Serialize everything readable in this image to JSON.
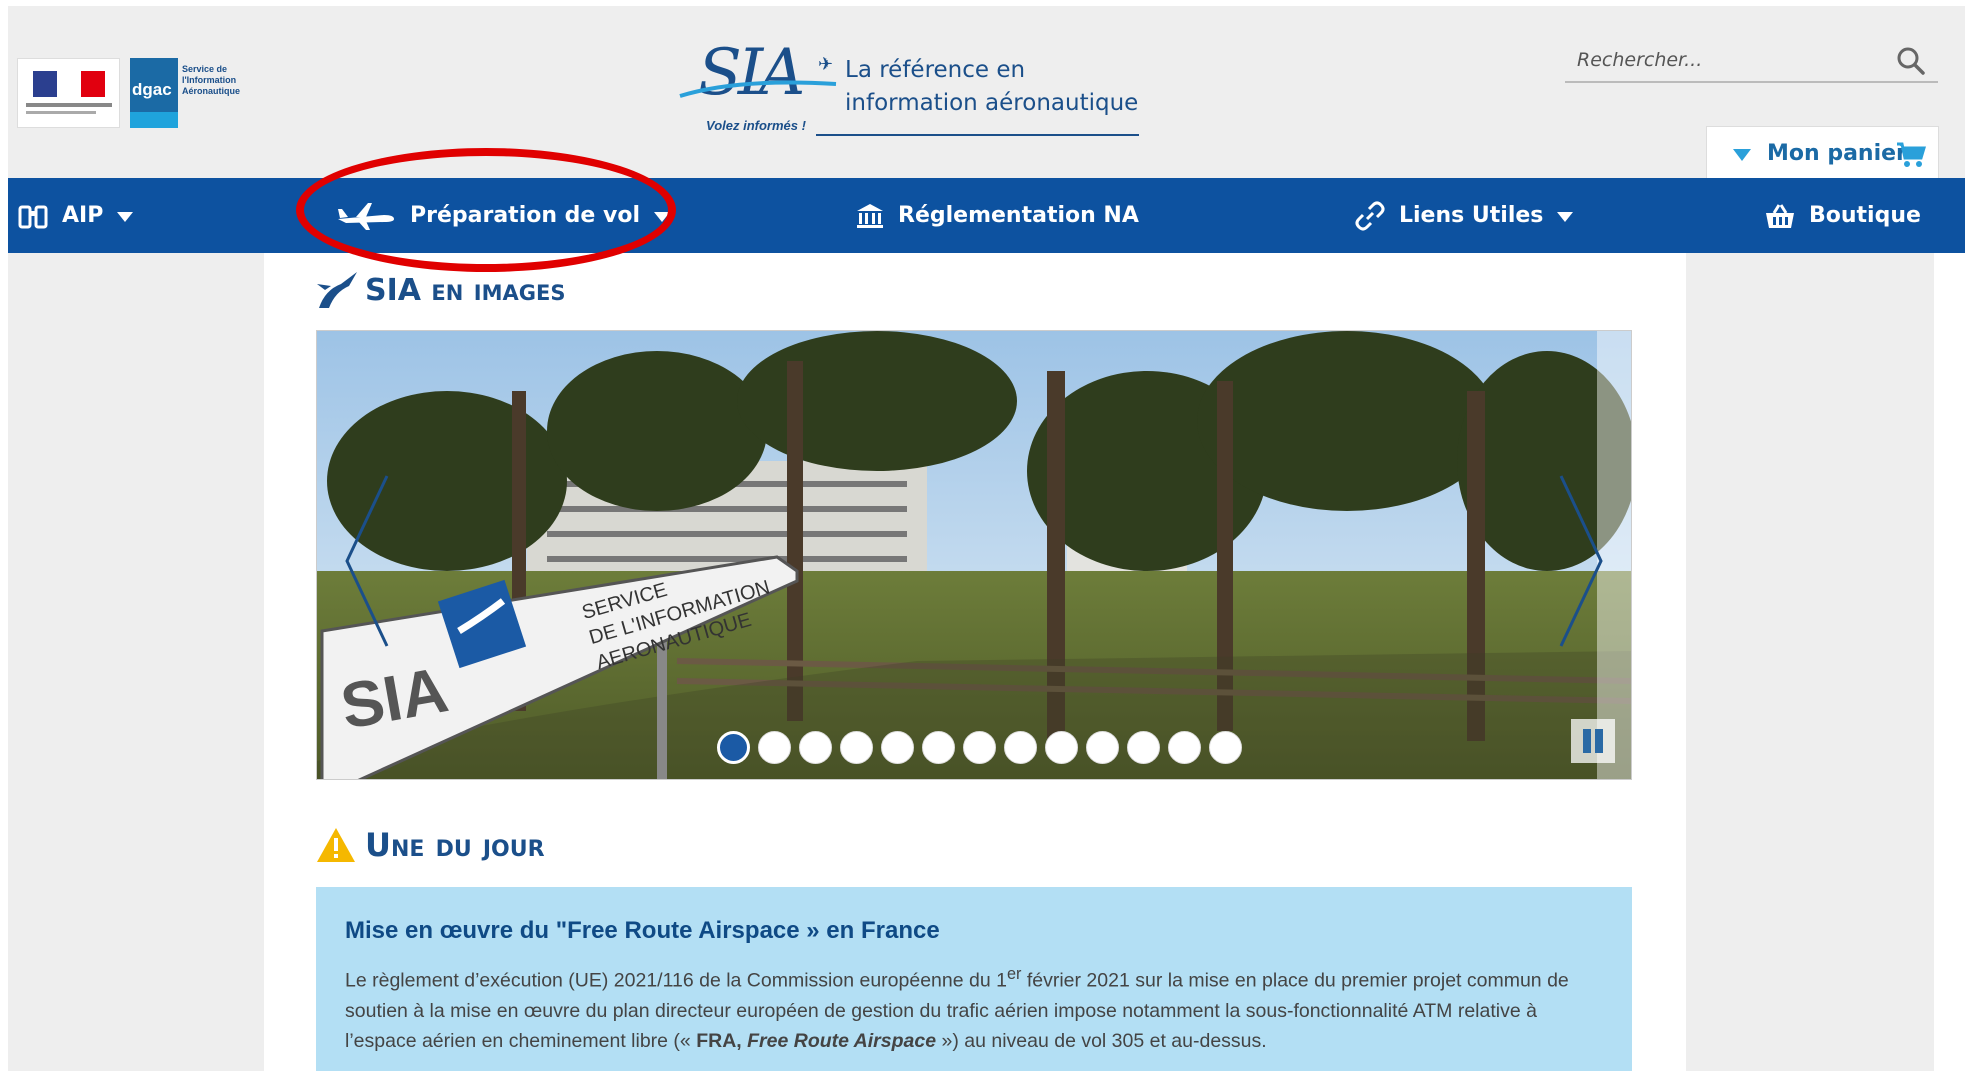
{
  "header": {
    "site_name": "SIA",
    "slogan": "Volez informés !",
    "tagline_line1": "La référence en",
    "tagline_line2": "information aéronautique",
    "dgac_logo_text": "dgac",
    "dgac_service_text": "Service de l'Information Aéronautique",
    "search": {
      "placeholder": "Rechercher...",
      "icon": "search-icon"
    },
    "cart": {
      "label": "Mon panier",
      "icon": "cart-icon"
    }
  },
  "nav": {
    "items": [
      {
        "label": "AIP",
        "icon": "binoculars-icon",
        "has_dropdown": true
      },
      {
        "label": "Préparation de vol",
        "icon": "airplane-icon",
        "has_dropdown": true
      },
      {
        "label": "Réglementation NA",
        "icon": "institution-icon",
        "has_dropdown": false
      },
      {
        "label": "Liens Utiles",
        "icon": "link-icon",
        "has_dropdown": true
      },
      {
        "label": "Boutique",
        "icon": "basket-icon",
        "has_dropdown": false
      }
    ]
  },
  "sia_images": {
    "title": "SIA en images",
    "carousel": {
      "total_slides": 13,
      "active_index": 0
    },
    "sign_text_1": "SERVICE",
    "sign_text_2": "DE L'INFORMATION",
    "sign_text_3": "AERONAUTIQUE",
    "sign_logo": "SIA"
  },
  "une_du_jour": {
    "title": "Une du jour",
    "news_title": "Mise en œuvre du \"Free Route Airspace » en France",
    "body_part1": "Le règlement d’exécution (UE) 2021/116 de la Commission européenne du 1",
    "body_sup": "er",
    "body_part2": " février 2021 sur la mise en place du premier projet commun de soutien à la mise en œuvre du plan directeur européen de gestion du trafic aérien impose notamment la sous-fonctionnalité ATM relative à l’espace aérien en cheminement libre (« ",
    "body_bold": "FRA, ",
    "body_bold_italic": "Free Route Airspace",
    "body_part3": " ») au niveau de vol 305 et au-dessus."
  },
  "colors": {
    "nav_bg": "#0d52a0",
    "accent": "#1b4f8a",
    "highlight": "#e00000",
    "news_bg": "#b3dff4"
  }
}
